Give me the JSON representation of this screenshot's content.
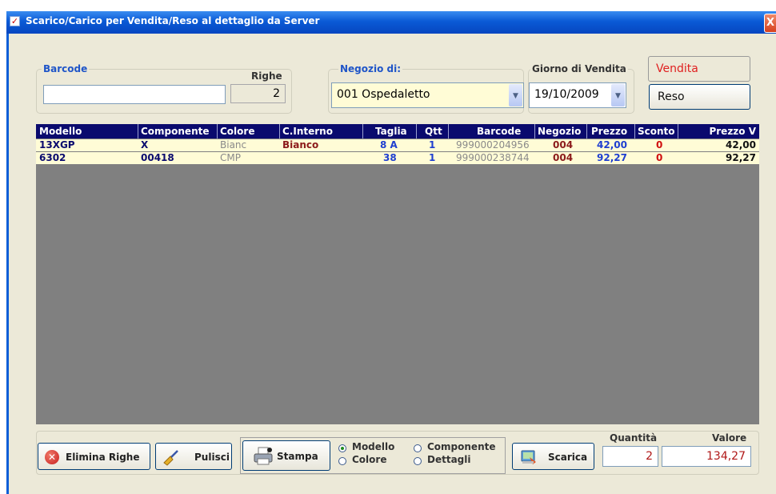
{
  "window": {
    "title": "Scarico/Carico per Vendita/Reso al dettaglio da Server",
    "close_glyph": "X"
  },
  "barcode": {
    "label": "Barcode",
    "value": ""
  },
  "righe": {
    "label": "Righe",
    "value": "2"
  },
  "negozio": {
    "label": "Negozio di:",
    "value": "001  Ospedaletto"
  },
  "giorno": {
    "label": "Giorno di Vendita",
    "value": "19/10/2009"
  },
  "mode_buttons": {
    "vendita": "Vendita",
    "reso": "Reso"
  },
  "table": {
    "columns": [
      "Modello",
      "Componente",
      "Colore",
      "C.Interno",
      "Taglia",
      "Qtt",
      "Barcode",
      "Negozio",
      "Prezzo",
      "Sconto",
      "Prezzo V"
    ],
    "rows": [
      {
        "modello": "13XGP",
        "componente": "X",
        "colore": "Bianc",
        "cinterno": "Bianco",
        "taglia": "8 A",
        "qtt": "1",
        "barcode": "999000204956",
        "negozio": "004",
        "prezzo": "42,00",
        "sconto": "0",
        "prezzov": "42,00"
      },
      {
        "modello": "6302",
        "componente": "00418",
        "colore": "CMP",
        "cinterno": "",
        "taglia": "38",
        "qtt": "1",
        "barcode": "999000238744",
        "negozio": "004",
        "prezzo": "92,27",
        "sconto": "0",
        "prezzov": "92,27"
      }
    ]
  },
  "actions": {
    "elimina": "Elimina Righe",
    "pulisci": "Pulisci",
    "stampa": "Stampa",
    "scarica": "Scarica"
  },
  "print_options": {
    "modello": "Modello",
    "componente": "Componente",
    "colore": "Colore",
    "dettagli": "Dettagli",
    "selected": "Modello"
  },
  "totals": {
    "quantita_label": "Quantità",
    "quantita": "2",
    "valore_label": "Valore",
    "valore": "134,27"
  },
  "icons": [
    "check-icon",
    "close-icon",
    "dropdown-arrow-icon",
    "delete-icon",
    "broom-icon",
    "printer-icon",
    "unload-icon"
  ],
  "colors": {
    "title_bar": "#0a5ad6",
    "grid_header": "#0a0a6e",
    "grid_row": "#fffcd6",
    "grid_empty": "#808080",
    "vendita_text": "#e02020",
    "valore_text": "#b01818"
  }
}
